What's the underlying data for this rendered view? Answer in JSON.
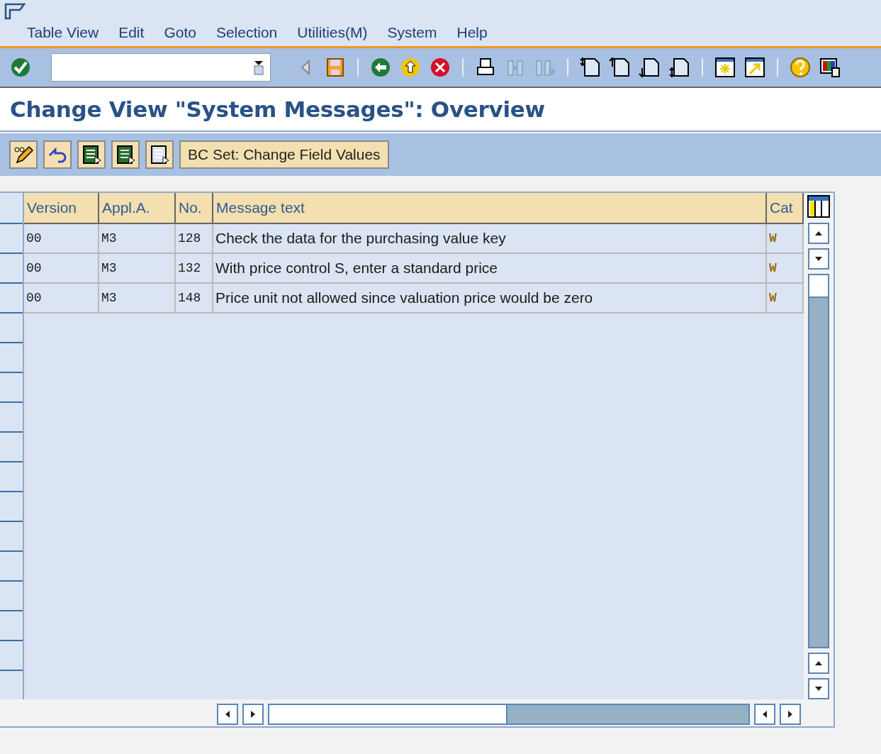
{
  "menu": [
    "Table View",
    "Edit",
    "Goto",
    "Selection",
    "Utilities(M)",
    "System",
    "Help"
  ],
  "title": "Change View \"System Messages\": Overview",
  "app_toolbar": {
    "button": "BC Set: Change Field Values"
  },
  "table": {
    "columns": [
      "Version",
      "Appl.A.",
      "No.",
      "Message text",
      "Cat"
    ],
    "rows": [
      {
        "cells": [
          "00",
          "M3",
          "128",
          "Check the data for the purchasing value key",
          "W"
        ],
        "selected": false
      },
      {
        "cells": [
          "00",
          "M3",
          "132",
          "With price control S, enter a standard price",
          "W"
        ],
        "selected": false
      },
      {
        "cells": [
          "00",
          "M3",
          "148",
          "Price unit not allowed since valuation price would be zero",
          "W"
        ],
        "selected": false
      }
    ]
  }
}
